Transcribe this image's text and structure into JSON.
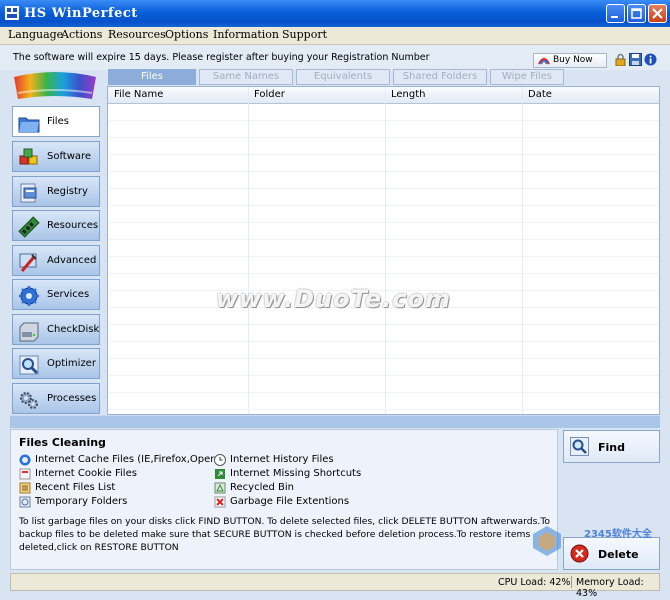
{
  "window": {
    "title": "HS WinPerfect"
  },
  "menu": [
    "Language",
    "Actions",
    "Resources",
    "Options",
    "Information",
    "Support"
  ],
  "notice": "The software will expire 15 days. Please register after buying your Registration Number",
  "buy_now": "Buy Now",
  "nav": [
    {
      "label": "Files",
      "icon": "folder-icon"
    },
    {
      "label": "Software",
      "icon": "cubes-icon"
    },
    {
      "label": "Registry",
      "icon": "registry-icon"
    },
    {
      "label": "Resources",
      "icon": "memory-chip-icon"
    },
    {
      "label": "Advanced",
      "icon": "advanced-icon"
    },
    {
      "label": "Services",
      "icon": "gear-icon"
    },
    {
      "label": "CheckDisk",
      "icon": "disk-icon"
    },
    {
      "label": "Optimizer",
      "icon": "magnifier-icon"
    },
    {
      "label": "Processes",
      "icon": "gears-icon"
    }
  ],
  "tabs": [
    "Files",
    "Same Names",
    "Equivalents",
    "Shared Folders",
    "Wipe Files"
  ],
  "columns": [
    "File Name",
    "Folder",
    "Length",
    "Date"
  ],
  "info": {
    "title": "Files Cleaning",
    "left": [
      "Internet Cache Files (IE,Firefox,Opera)",
      "Internet Cookie Files",
      "Recent Files List",
      "Temporary Folders"
    ],
    "right": [
      "Internet History Files",
      "Internet Missing Shortcuts",
      "Recycled Bin",
      "Garbage File Extentions"
    ],
    "help": "To list garbage files on your disks click FIND BUTTON. To delete selected files, click DELETE BUTTON aftwerwards.To backup files to be deleted make sure that SECURE BUTTON is checked before deletion process.To restore items deleted,click on RESTORE BUTTON"
  },
  "actions": {
    "find": "Find",
    "delete": "Delete"
  },
  "status": {
    "cpu": "CPU Load: 42%",
    "memory": "Memory Load: 43%"
  },
  "watermark": "www.DuoTe.com",
  "brand": "2345软件大全"
}
